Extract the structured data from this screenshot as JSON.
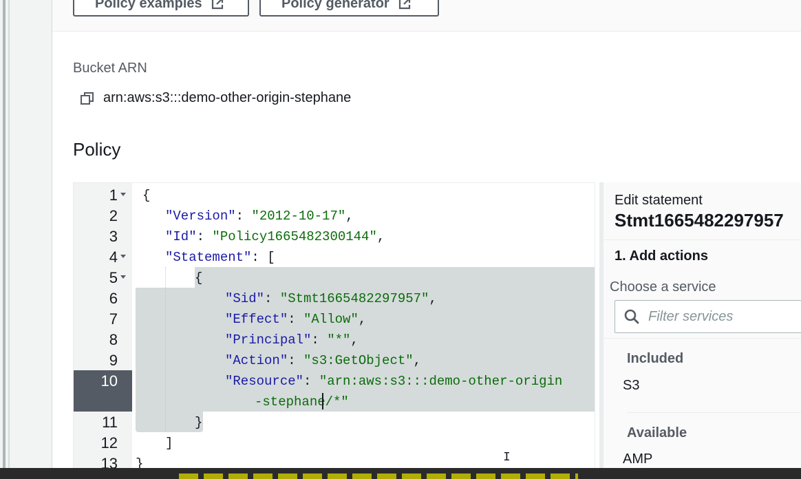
{
  "toolbar": {
    "policy_examples_label": "Policy examples",
    "policy_generator_label": "Policy generator"
  },
  "bucket": {
    "arn_label": "Bucket ARN",
    "arn_value": "arn:aws:s3:::demo-other-origin-stephane"
  },
  "policy": {
    "heading": "Policy",
    "lines": [
      {
        "n": "1",
        "text": "{"
      },
      {
        "n": "2",
        "k": "\"Version\"",
        "sep": ": ",
        "v": "\"2012-10-17\"",
        "end": ","
      },
      {
        "n": "3",
        "k": "\"Id\"",
        "sep": ": ",
        "v": "\"Policy1665482300144\"",
        "end": ","
      },
      {
        "n": "4",
        "k": "\"Statement\"",
        "sep": ": [",
        "v": "",
        "end": ""
      },
      {
        "n": "5",
        "text": "{"
      },
      {
        "n": "6",
        "k": "\"Sid\"",
        "sep": ": ",
        "v": "\"Stmt1665482297957\"",
        "end": ","
      },
      {
        "n": "7",
        "k": "\"Effect\"",
        "sep": ": ",
        "v": "\"Allow\"",
        "end": ","
      },
      {
        "n": "8",
        "k": "\"Principal\"",
        "sep": ": ",
        "v": "\"*\"",
        "end": ","
      },
      {
        "n": "9",
        "k": "\"Action\"",
        "sep": ": ",
        "v": "\"s3:GetObject\"",
        "end": ","
      },
      {
        "n": "10",
        "k": "\"Resource\"",
        "sep": ": ",
        "v": "\"arn:aws:s3:::demo-other-origin",
        "end": ""
      },
      {
        "n": "",
        "v": "-stephane/*\"",
        "end": ""
      },
      {
        "n": "11",
        "text": "}"
      },
      {
        "n": "12",
        "text": "]"
      },
      {
        "n": "13",
        "text": "}"
      }
    ]
  },
  "edit_panel": {
    "subtitle": "Edit statement",
    "title": "Stmt1665482297957",
    "step": "1. Add actions",
    "choose_label": "Choose a service",
    "search_placeholder": "Filter services",
    "included_heading": "Included",
    "included_items": [
      "S3"
    ],
    "available_heading": "Available",
    "available_items": [
      "AMP"
    ]
  },
  "colors": {
    "json_key": "#1a1aa6",
    "json_string": "#0b6c0b",
    "selection": "#d5dbdb",
    "active_line_gutter": "#545b64"
  },
  "icons": [
    "external-link-icon",
    "copy-icon",
    "search-icon",
    "fold-arrow-icon"
  ]
}
